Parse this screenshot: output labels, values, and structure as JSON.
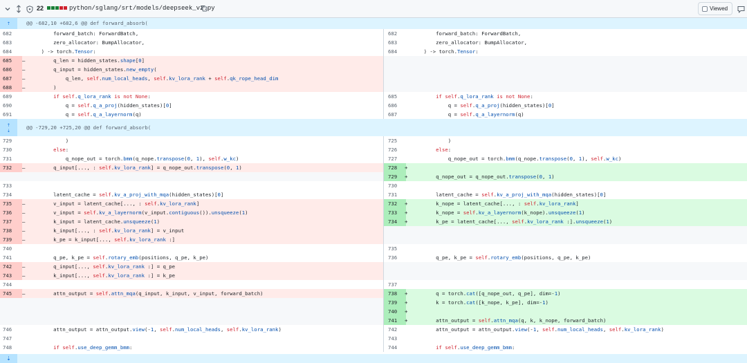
{
  "file": {
    "change_count": "22",
    "path": "python/sglang/srt/models/deepseek_v2.py",
    "viewed_label": "Viewed",
    "stat_colors": [
      "#1a7f37",
      "#1a7f37",
      "#1a7f37",
      "#cf222e",
      "#cf222e"
    ]
  },
  "diff": [
    {
      "t": "hunk",
      "h": 1,
      "text": "@@ -682,10 +682,6 @@ def forward_absorb("
    },
    {
      "t": "row",
      "l": {
        "n": "682",
        "k": "ctx",
        "c": "        forward_batch: ForwardBatch,"
      },
      "r": {
        "n": "682",
        "k": "ctx",
        "c": "        forward_batch: ForwardBatch,"
      }
    },
    {
      "t": "row",
      "l": {
        "n": "683",
        "k": "ctx",
        "c": "        zero_allocator: BumpAllocator,"
      },
      "r": {
        "n": "683",
        "k": "ctx",
        "c": "        zero_allocator: BumpAllocator,"
      }
    },
    {
      "t": "row",
      "l": {
        "n": "684",
        "k": "ctx",
        "c": "    ) -> torch.Tensor:"
      },
      "r": {
        "n": "684",
        "k": "ctx",
        "c": "    ) -> torch.Tensor:"
      }
    },
    {
      "t": "row",
      "l": {
        "n": "685",
        "k": "del",
        "c": "        q_len = hidden_states.shape[0]"
      },
      "r": {
        "k": "empty"
      }
    },
    {
      "t": "row",
      "l": {
        "n": "686",
        "k": "del",
        "c": "        q_input = hidden_states.new_empty("
      },
      "r": {
        "k": "empty"
      }
    },
    {
      "t": "row",
      "l": {
        "n": "687",
        "k": "del",
        "c": "            q_len, self.num_local_heads, self.kv_lora_rank + self.qk_rope_head_dim"
      },
      "r": {
        "k": "empty"
      }
    },
    {
      "t": "row",
      "l": {
        "n": "688",
        "k": "del",
        "c": "        )"
      },
      "r": {
        "k": "empty"
      }
    },
    {
      "t": "row",
      "l": {
        "n": "689",
        "k": "ctx",
        "c": "        if self.q_lora_rank is not None:"
      },
      "r": {
        "n": "685",
        "k": "ctx",
        "c": "        if self.q_lora_rank is not None:"
      }
    },
    {
      "t": "row",
      "l": {
        "n": "690",
        "k": "ctx",
        "c": "            q = self.q_a_proj(hidden_states)[0]"
      },
      "r": {
        "n": "686",
        "k": "ctx",
        "c": "            q = self.q_a_proj(hidden_states)[0]"
      }
    },
    {
      "t": "row",
      "l": {
        "n": "691",
        "k": "ctx",
        "c": "            q = self.q_a_layernorm(q)"
      },
      "r": {
        "n": "687",
        "k": "ctx",
        "c": "            q = self.q_a_layernorm(q)"
      }
    },
    {
      "t": "hunk",
      "h": 2,
      "text": "@@ -729,20 +725,20 @@ def forward_absorb("
    },
    {
      "t": "row",
      "l": {
        "n": "729",
        "k": "ctx",
        "c": "            )"
      },
      "r": {
        "n": "725",
        "k": "ctx",
        "c": "            )"
      }
    },
    {
      "t": "row",
      "l": {
        "n": "730",
        "k": "ctx",
        "c": "        else:"
      },
      "r": {
        "n": "726",
        "k": "ctx",
        "c": "        else:"
      }
    },
    {
      "t": "row",
      "l": {
        "n": "731",
        "k": "ctx",
        "c": "            q_nope_out = torch.bmm(q_nope.transpose(0, 1), self.w_kc)"
      },
      "r": {
        "n": "727",
        "k": "ctx",
        "c": "            q_nope_out = torch.bmm(q_nope.transpose(0, 1), self.w_kc)"
      }
    },
    {
      "t": "row",
      "l": {
        "n": "732",
        "k": "del",
        "c": "        q_input[..., : self.kv_lora_rank] = q_nope_out.transpose(0, 1)"
      },
      "r": {
        "n": "728",
        "k": "add",
        "c": ""
      }
    },
    {
      "t": "row",
      "l": {
        "k": "empty"
      },
      "r": {
        "n": "729",
        "k": "add",
        "c": "        q_nope_out = q_nope_out.transpose(0, 1)"
      }
    },
    {
      "t": "row",
      "l": {
        "n": "733",
        "k": "ctx",
        "c": ""
      },
      "r": {
        "n": "730",
        "k": "ctx",
        "c": ""
      }
    },
    {
      "t": "row",
      "l": {
        "n": "734",
        "k": "ctx",
        "c": "        latent_cache = self.kv_a_proj_with_mqa(hidden_states)[0]"
      },
      "r": {
        "n": "731",
        "k": "ctx",
        "c": "        latent_cache = self.kv_a_proj_with_mqa(hidden_states)[0]"
      }
    },
    {
      "t": "row",
      "l": {
        "n": "735",
        "k": "del",
        "c": "        v_input = latent_cache[..., : self.kv_lora_rank]"
      },
      "r": {
        "n": "732",
        "k": "add",
        "c": "        k_nope = latent_cache[..., : self.kv_lora_rank]"
      }
    },
    {
      "t": "row",
      "l": {
        "n": "736",
        "k": "del",
        "c": "        v_input = self.kv_a_layernorm(v_input.contiguous()).unsqueeze(1)"
      },
      "r": {
        "n": "733",
        "k": "add",
        "c": "        k_nope = self.kv_a_layernorm(k_nope).unsqueeze(1)"
      }
    },
    {
      "t": "row",
      "l": {
        "n": "737",
        "k": "del",
        "c": "        k_input = latent_cache.unsqueeze(1)"
      },
      "r": {
        "n": "734",
        "k": "add",
        "c": "        k_pe = latent_cache[..., self.kv_lora_rank :].unsqueeze(1)"
      }
    },
    {
      "t": "row",
      "l": {
        "n": "738",
        "k": "del",
        "c": "        k_input[..., : self.kv_lora_rank] = v_input"
      },
      "r": {
        "k": "empty"
      }
    },
    {
      "t": "row",
      "l": {
        "n": "739",
        "k": "del",
        "c": "        k_pe = k_input[..., self.kv_lora_rank :]"
      },
      "r": {
        "k": "empty"
      }
    },
    {
      "t": "row",
      "l": {
        "n": "740",
        "k": "ctx",
        "c": ""
      },
      "r": {
        "n": "735",
        "k": "ctx",
        "c": ""
      }
    },
    {
      "t": "row",
      "l": {
        "n": "741",
        "k": "ctx",
        "c": "        q_pe, k_pe = self.rotary_emb(positions, q_pe, k_pe)"
      },
      "r": {
        "n": "736",
        "k": "ctx",
        "c": "        q_pe, k_pe = self.rotary_emb(positions, q_pe, k_pe)"
      }
    },
    {
      "t": "row",
      "l": {
        "n": "742",
        "k": "del",
        "c": "        q_input[..., self.kv_lora_rank :] = q_pe"
      },
      "r": {
        "k": "empty"
      }
    },
    {
      "t": "row",
      "l": {
        "n": "743",
        "k": "del",
        "c": "        k_input[..., self.kv_lora_rank :] = k_pe"
      },
      "r": {
        "k": "empty"
      }
    },
    {
      "t": "row",
      "l": {
        "n": "744",
        "k": "ctx",
        "c": ""
      },
      "r": {
        "n": "737",
        "k": "ctx",
        "c": ""
      }
    },
    {
      "t": "row",
      "l": {
        "n": "745",
        "k": "del",
        "c": "        attn_output = self.attn_mqa(q_input, k_input, v_input, forward_batch)"
      },
      "r": {
        "n": "738",
        "k": "add",
        "c": "        q = torch.cat([q_nope_out, q_pe], dim=-1)"
      }
    },
    {
      "t": "row",
      "l": {
        "k": "empty"
      },
      "r": {
        "n": "739",
        "k": "add",
        "c": "        k = torch.cat([k_nope, k_pe], dim=-1)"
      }
    },
    {
      "t": "row",
      "l": {
        "k": "empty"
      },
      "r": {
        "n": "740",
        "k": "add",
        "c": ""
      }
    },
    {
      "t": "row",
      "l": {
        "k": "empty"
      },
      "r": {
        "n": "741",
        "k": "add",
        "c": "        attn_output = self.attn_mqa(q, k, k_nope, forward_batch)"
      }
    },
    {
      "t": "row",
      "l": {
        "n": "746",
        "k": "ctx",
        "c": "        attn_output = attn_output.view(-1, self.num_local_heads, self.kv_lora_rank)"
      },
      "r": {
        "n": "742",
        "k": "ctx",
        "c": "        attn_output = attn_output.view(-1, self.num_local_heads, self.kv_lora_rank)"
      }
    },
    {
      "t": "row",
      "l": {
        "n": "747",
        "k": "ctx",
        "c": ""
      },
      "r": {
        "n": "743",
        "k": "ctx",
        "c": ""
      }
    },
    {
      "t": "row",
      "l": {
        "n": "748",
        "k": "ctx",
        "c": "        if self.use_deep_gemm_bmm:"
      },
      "r": {
        "n": "744",
        "k": "ctx",
        "c": "        if self.use_deep_gemm_bmm:"
      }
    }
  ]
}
